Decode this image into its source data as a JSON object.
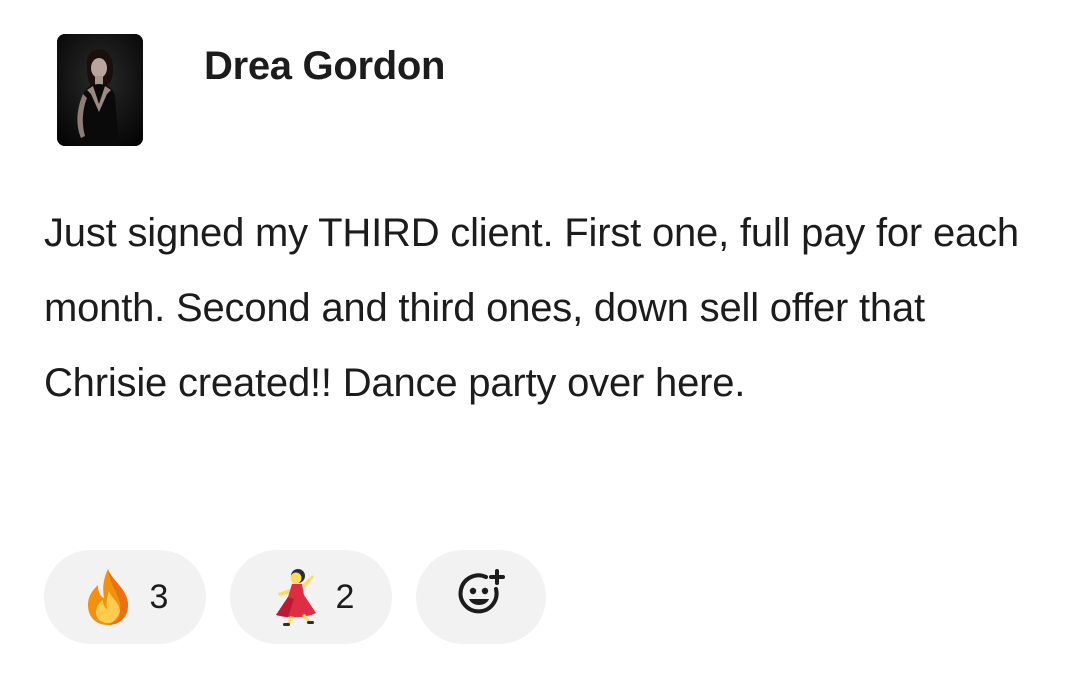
{
  "post": {
    "author": "Drea Gordon",
    "message": "Just signed my THIRD client. First one, full pay for each month. Second and third ones, down sell offer that Chrisie created!! Dance party over here."
  },
  "reactions": [
    {
      "icon": "fire-emoji-icon",
      "count": "3"
    },
    {
      "icon": "dancing-woman-emoji-icon",
      "count": "2"
    }
  ],
  "add_reaction": {
    "icon": "add-reaction-icon"
  },
  "colors": {
    "text": "#1d1c1d",
    "pill_background": "#f2f2f2",
    "fire_orange": "#f4900c",
    "dress_red": "#dd2e44"
  }
}
